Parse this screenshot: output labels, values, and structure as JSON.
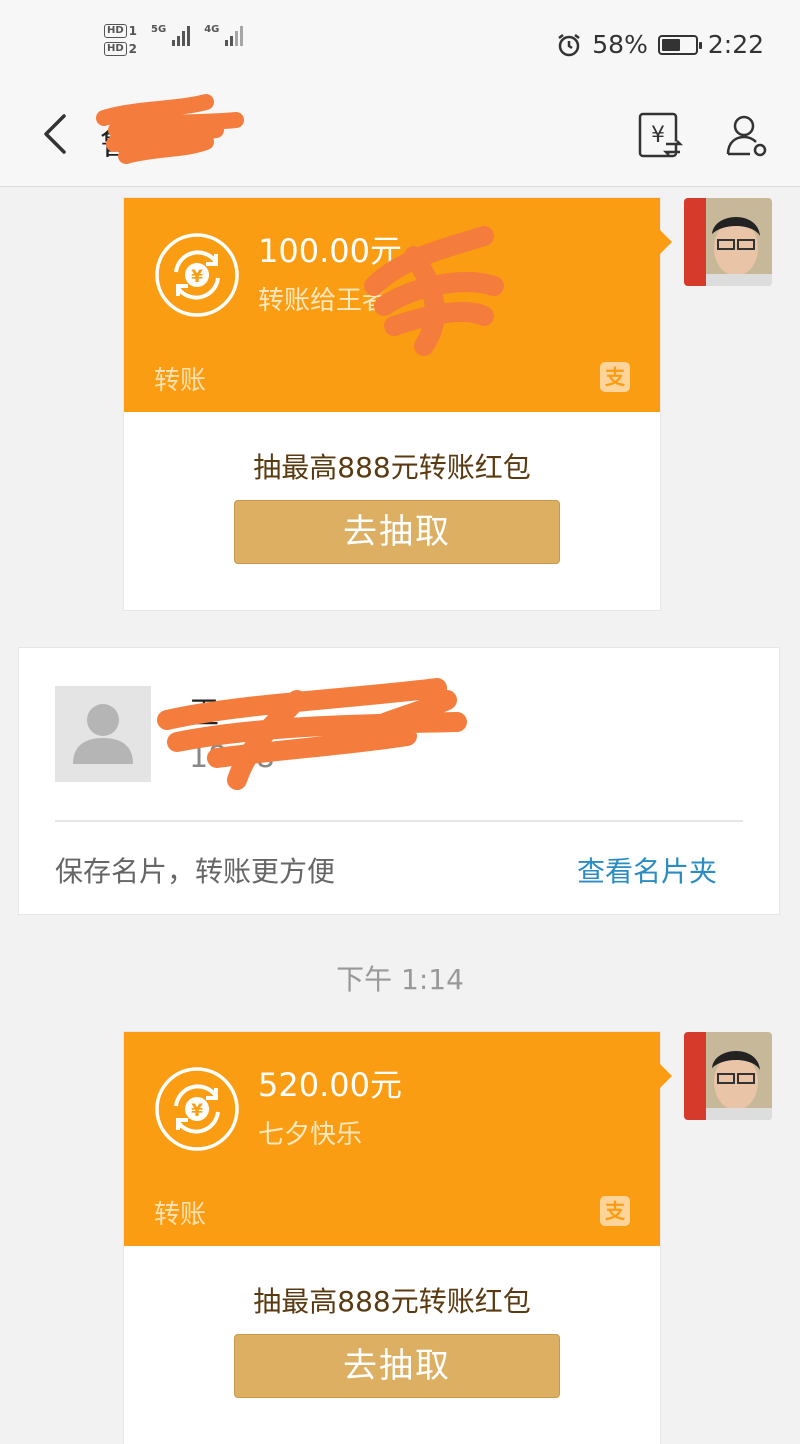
{
  "status_bar": {
    "sim1": "HD",
    "sim1_slot": "1",
    "sim2": "HD",
    "sim2_slot": "2",
    "net1": "5G",
    "net2": "4G",
    "battery": "58%",
    "battery_level": 0.58,
    "time": "2:22"
  },
  "nav": {
    "title": "鲁"
  },
  "messages": [
    {
      "amount": "100.00元",
      "remark": "转账给王者",
      "label": "转账",
      "alipay_mark": "支",
      "promo": "抽最高888元转账红包",
      "button": "去抽取"
    },
    {
      "amount": "520.00元",
      "remark": "七夕快乐",
      "label": "转账",
      "alipay_mark": "支",
      "promo": "抽最高888元转账红包",
      "button": "去抽取"
    }
  ],
  "contact_card": {
    "name": "王",
    "phone": "18          38",
    "save_tip": "保存名片，转账更方便",
    "view_link": "查看名片夹"
  },
  "timestamp": "下午 1:14",
  "colors": {
    "transfer_orange": "#fa9d12",
    "button_gold": "#dcaf62",
    "link_blue": "#2b8cc4"
  }
}
